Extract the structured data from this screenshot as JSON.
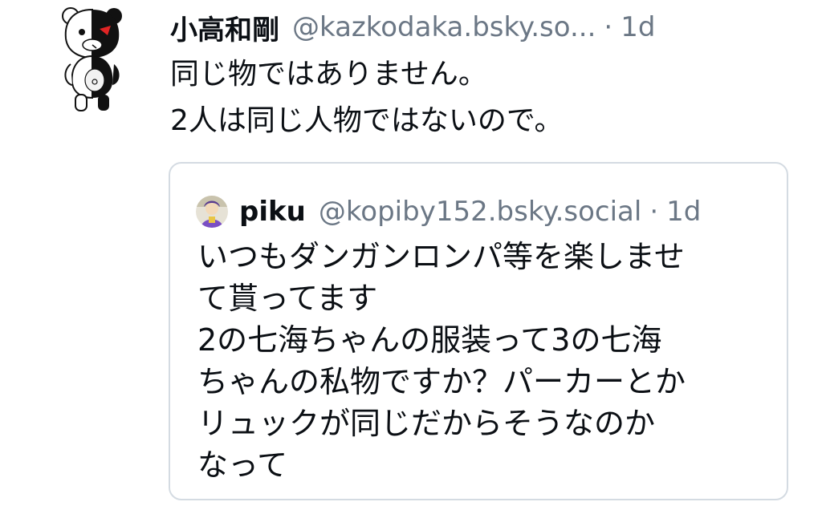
{
  "post": {
    "author": {
      "display_name": "小高和剛",
      "handle": "@kazkodaka.bsky.so...",
      "avatar_icon": "monokuma-bear-avatar-icon"
    },
    "separator": "·",
    "timestamp": "1d",
    "text_lines": [
      "同じ物ではありません。",
      "2人は同じ人物ではないので。"
    ]
  },
  "quote": {
    "author": {
      "display_name": "piku",
      "handle": "@kopiby152.bsky.social",
      "avatar_icon": "purple-character-avatar-icon"
    },
    "separator": "·",
    "timestamp": "1d",
    "text_lines": [
      "いつもダンガンロンパ等を楽しませ",
      "て貰ってます",
      "2の七海ちゃんの服装って3の七海",
      "ちゃんの私物ですか？パーカーとか",
      "リュックが同じだからそうなのか",
      "なって"
    ]
  },
  "colors": {
    "text_primary": "#0b0f14",
    "text_secondary": "#6b7785",
    "border": "#d4dbe2",
    "background": "#ffffff"
  }
}
